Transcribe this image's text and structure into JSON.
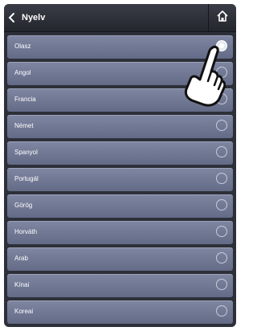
{
  "header": {
    "title": "Nyelv",
    "back_icon": "chevron-left-icon",
    "home_icon": "home-icon"
  },
  "languages": [
    {
      "label": "Olasz",
      "selected": true
    },
    {
      "label": "Angol",
      "selected": false
    },
    {
      "label": "Francia",
      "selected": false
    },
    {
      "label": "Német",
      "selected": false
    },
    {
      "label": "Spanyol",
      "selected": false
    },
    {
      "label": "Portugál",
      "selected": false
    },
    {
      "label": "Görög",
      "selected": false
    },
    {
      "label": "Horváth",
      "selected": false
    },
    {
      "label": "Arab",
      "selected": false
    },
    {
      "label": "Kínai",
      "selected": false
    },
    {
      "label": "Koreai",
      "selected": false
    }
  ],
  "colors": {
    "background": "#2d3039",
    "row": "#737a96",
    "text": "#ffffff"
  }
}
